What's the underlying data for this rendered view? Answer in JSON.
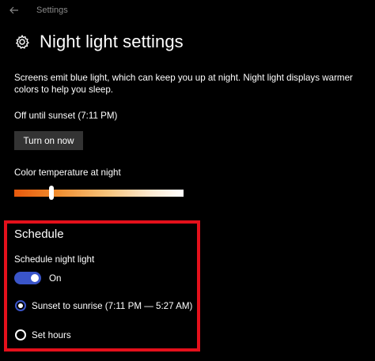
{
  "titlebar": {
    "back_icon": "arrow-left-icon",
    "app_title": "Settings"
  },
  "header": {
    "icon": "gear-icon",
    "title": "Night light settings"
  },
  "description": "Screens emit blue light, which can keep you up at night. Night light displays warmer colors to help you sleep.",
  "status": "Off until sunset (7:11 PM)",
  "turn_on_button": "Turn on now",
  "color_temperature": {
    "label": "Color temperature at night",
    "value_fraction": 0.22,
    "gradient_start": "#e8590c",
    "gradient_end": "#ffffff"
  },
  "schedule": {
    "heading": "Schedule",
    "toggle_label": "Schedule night light",
    "toggle_state": "On",
    "toggle_on": true,
    "accent_color": "#3a55c9",
    "highlight_border_color": "#e4101b",
    "options": [
      {
        "label": "Sunset to sunrise (7:11 PM — 5:27 AM)",
        "selected": true
      },
      {
        "label": "Set hours",
        "selected": false
      }
    ]
  }
}
